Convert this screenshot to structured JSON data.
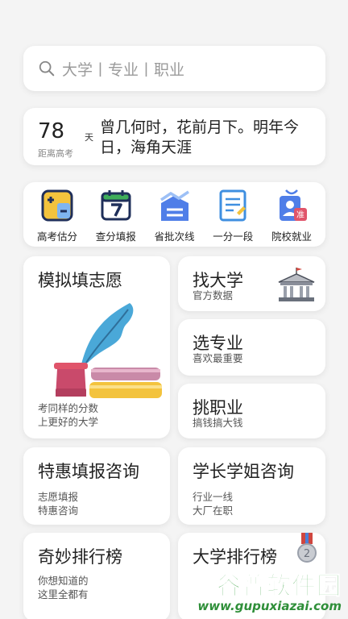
{
  "search": {
    "placeholder": "大学丨专业丨职业"
  },
  "countdown": {
    "days": "78",
    "unit": "天",
    "label": "距离高考",
    "quote": "曾几何时，花前月下。明年今日，海角天涯"
  },
  "tools": [
    {
      "label": "高考估分",
      "icon": "calculator-icon"
    },
    {
      "label": "查分填报",
      "icon": "calendar-icon"
    },
    {
      "label": "省批次线",
      "icon": "chart-icon"
    },
    {
      "label": "一分一段",
      "icon": "document-icon"
    },
    {
      "label": "院校就业",
      "icon": "employee-badge-icon"
    }
  ],
  "cards": {
    "mock": {
      "title": "模拟填志愿",
      "sub1": "考同样的分数",
      "sub2": "上更好的大学"
    },
    "find_university": {
      "title": "找大学",
      "sub": "官方数据"
    },
    "choose_major": {
      "title": "选专业",
      "sub": "喜欢最重要"
    },
    "choose_career": {
      "title": "挑职业",
      "sub": "搞钱搞大钱"
    },
    "discount_consult": {
      "title": "特惠填报咨询",
      "sub1": "志愿填报",
      "sub2": "特惠咨询"
    },
    "senior_consult": {
      "title": "学长学姐咨询",
      "sub1": "行业一线",
      "sub2": "大厂在职"
    },
    "fun_ranking": {
      "title": "奇妙排行榜",
      "sub1": "你想知道的",
      "sub2": "这里全都有"
    },
    "university_ranking": {
      "title": "大学排行榜"
    }
  },
  "badge_text": "准",
  "medal_text": "2",
  "watermark": {
    "title": "谷普软件园",
    "url": "www.gupuxiazai.com"
  },
  "colors": {
    "accent_blue": "#3f6fd8",
    "ink_blue": "#4aa8d8",
    "book_red": "#c94a6b",
    "book_yellow": "#f3c33d",
    "watermark_green": "#3ca344"
  }
}
